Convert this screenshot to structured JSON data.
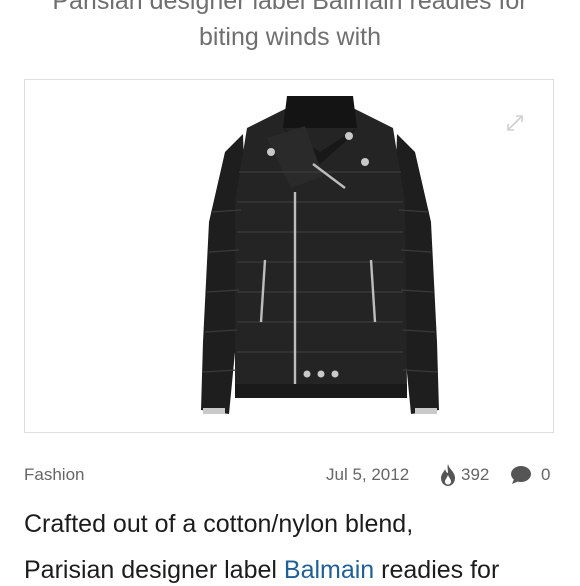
{
  "article": {
    "headline_line1": "Parisian designer label Balmain readies for",
    "headline_line2": "biting winds with",
    "category": "Fashion",
    "date": "Jul 5, 2012",
    "views": "392",
    "comments": "0",
    "body_line1": "Crafted out of a cotton/nylon blend,",
    "body_line2_before": "Parisian designer label ",
    "body_line2_link": "Balmain",
    "body_line2_after": " readies for"
  },
  "icons": {
    "expand": "expand-icon",
    "flame": "flame-icon",
    "comment": "comment-bubble-icon"
  },
  "colors": {
    "link": "#1f5f9a",
    "meta_text": "#666666",
    "headline_text": "#6f6f6f",
    "jacket": "#1e1e1e"
  }
}
